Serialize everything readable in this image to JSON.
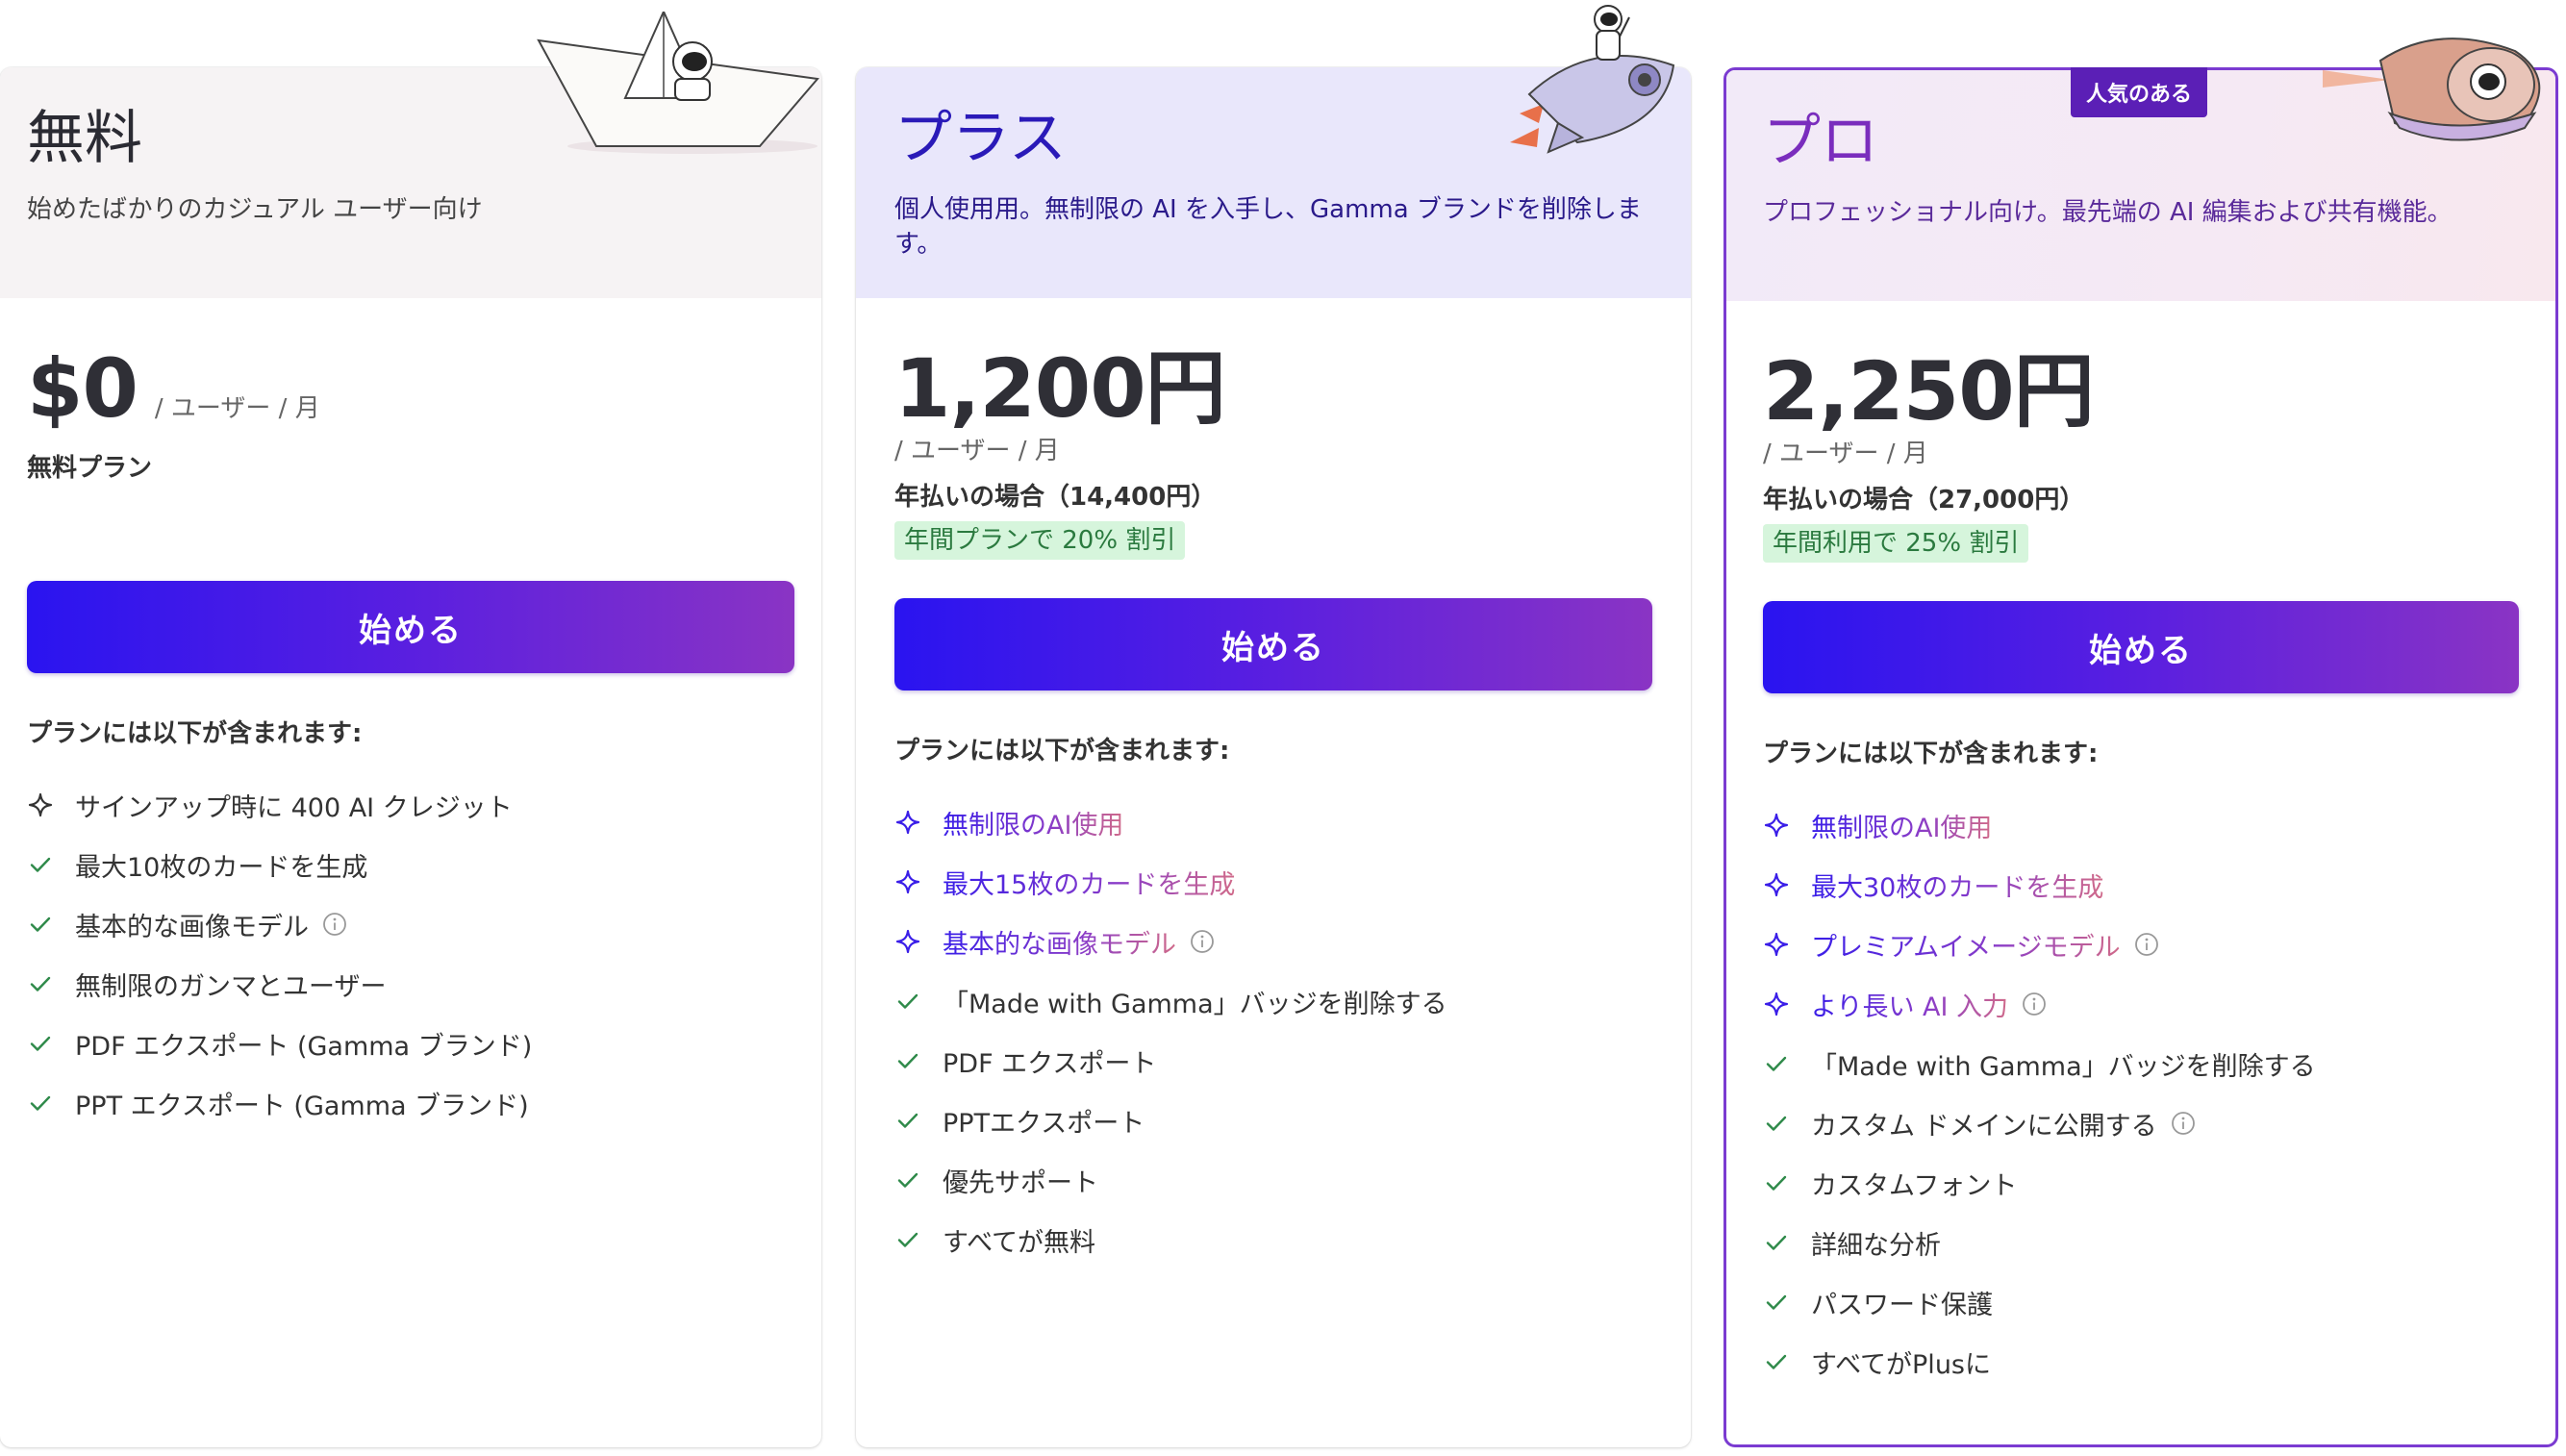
{
  "plans": [
    {
      "name": "無料",
      "description": "始めたばかりのカジュアル ユーザー向け",
      "price": "$0",
      "per": "/ ユーザー / 月",
      "note": "無料プラン",
      "discount": "",
      "cta": "始める",
      "includes_title": "プランには以下が含まれます:",
      "features": [
        {
          "text": "サインアップ時に 400 AI クレジット",
          "icon": "sparkle-icon",
          "highlight": false,
          "info": false
        },
        {
          "text": "最大10枚のカードを生成",
          "icon": "check-icon",
          "highlight": false,
          "info": false
        },
        {
          "text": "基本的な画像モデル",
          "icon": "check-icon",
          "highlight": false,
          "info": true
        },
        {
          "text": "無制限のガンマとユーザー",
          "icon": "check-icon",
          "highlight": false,
          "info": false
        },
        {
          "text": "PDF エクスポート (Gamma ブランド)",
          "icon": "check-icon",
          "highlight": false,
          "info": false
        },
        {
          "text": "PPT エクスポート (Gamma ブランド)",
          "icon": "check-icon",
          "highlight": false,
          "info": false
        }
      ]
    },
    {
      "name": "プラス",
      "description": "個人使用用。無制限の AI を入手し、Gamma ブランドを削除します。",
      "price": "1,200円",
      "per": "/ ユーザー / 月",
      "note": "年払いの場合（14,400円）",
      "discount": "年間プランで 20% 割引",
      "cta": "始める",
      "includes_title": "プランには以下が含まれます:",
      "features": [
        {
          "text": "無制限のAI使用",
          "icon": "sparkle-icon",
          "highlight": true,
          "info": false
        },
        {
          "text": "最大15枚のカードを生成",
          "icon": "sparkle-icon",
          "highlight": true,
          "info": false
        },
        {
          "text": "基本的な画像モデル",
          "icon": "sparkle-icon",
          "highlight": true,
          "info": true
        },
        {
          "text": "「Made with Gamma」バッジを削除する",
          "icon": "check-icon",
          "highlight": false,
          "info": false
        },
        {
          "text": "PDF エクスポート",
          "icon": "check-icon",
          "highlight": false,
          "info": false
        },
        {
          "text": "PPTエクスポート",
          "icon": "check-icon",
          "highlight": false,
          "info": false
        },
        {
          "text": "優先サポート",
          "icon": "check-icon",
          "highlight": false,
          "info": false
        },
        {
          "text": "すべてが無料",
          "icon": "check-icon",
          "highlight": false,
          "info": false
        }
      ]
    },
    {
      "name": "プロ",
      "badge": "人気のある",
      "description": "プロフェッショナル向け。最先端の AI 編集および共有機能。",
      "price": "2,250円",
      "per": "/ ユーザー / 月",
      "note": "年払いの場合（27,000円）",
      "discount": "年間利用で 25% 割引",
      "cta": "始める",
      "includes_title": "プランには以下が含まれます:",
      "features": [
        {
          "text": "無制限のAI使用",
          "icon": "sparkle-icon",
          "highlight": true,
          "info": false
        },
        {
          "text": "最大30枚のカードを生成",
          "icon": "sparkle-icon",
          "highlight": true,
          "info": false
        },
        {
          "text": "プレミアムイメージモデル",
          "icon": "sparkle-icon",
          "highlight": true,
          "info": true
        },
        {
          "text": "より長い AI 入力",
          "icon": "sparkle-icon",
          "highlight": true,
          "info": true
        },
        {
          "text": "「Made with Gamma」バッジを削除する",
          "icon": "check-icon",
          "highlight": false,
          "info": false
        },
        {
          "text": "カスタム ドメインに公開する",
          "icon": "check-icon",
          "highlight": false,
          "info": true
        },
        {
          "text": "カスタムフォント",
          "icon": "check-icon",
          "highlight": false,
          "info": false
        },
        {
          "text": "詳細な分析",
          "icon": "check-icon",
          "highlight": false,
          "info": false
        },
        {
          "text": "パスワード保護",
          "icon": "check-icon",
          "highlight": false,
          "info": false
        },
        {
          "text": "すべてがPlusに",
          "icon": "check-icon",
          "highlight": false,
          "info": false
        }
      ]
    }
  ],
  "colors": {
    "cta_start": "#2a14f0",
    "cta_end": "#8a34c4",
    "check": "#2f8a4a",
    "sparkle_free": "#333333",
    "sparkle_paid": "#3a1ee8",
    "badge": "#5b1fb6",
    "pro_border": "#7b3bd1"
  }
}
